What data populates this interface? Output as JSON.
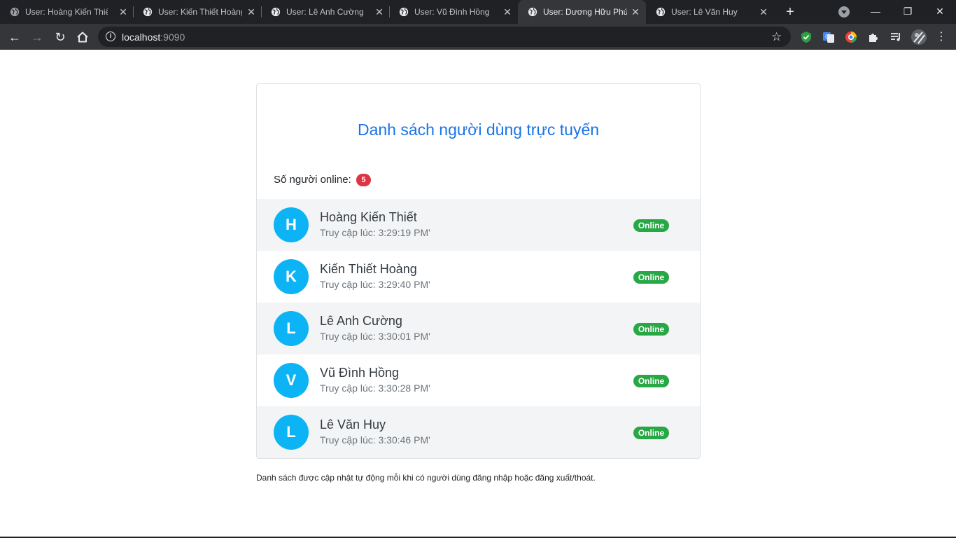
{
  "browser": {
    "tabs": [
      {
        "title": "User: Hoàng Kiến Thiết",
        "active": false
      },
      {
        "title": "User: Kiến Thiết Hoàng",
        "active": false
      },
      {
        "title": "User: Lê Anh Cường",
        "active": false
      },
      {
        "title": "User: Vũ Đình Hồng",
        "active": false
      },
      {
        "title": "User: Dương Hữu Phúc",
        "active": true
      },
      {
        "title": "User: Lê Văn Huy",
        "active": false
      }
    ],
    "address": {
      "host": "localhost",
      "port": ":9090"
    }
  },
  "page": {
    "title": "Danh sách người dùng trực tuyến",
    "online_label": "Số người online:",
    "online_count": "5",
    "users": [
      {
        "initial": "H",
        "name": "Hoàng Kiến Thiết",
        "access_time": "Truy cập lúc: 3:29:19 PM'",
        "status": "Online"
      },
      {
        "initial": "K",
        "name": "Kiến Thiết Hoàng",
        "access_time": "Truy cập lúc: 3:29:40 PM'",
        "status": "Online"
      },
      {
        "initial": "L",
        "name": "Lê Anh Cường",
        "access_time": "Truy cập lúc: 3:30:01 PM'",
        "status": "Online"
      },
      {
        "initial": "V",
        "name": "Vũ Đình Hồng",
        "access_time": "Truy cập lúc: 3:30:28 PM'",
        "status": "Online"
      },
      {
        "initial": "L",
        "name": "Lê Văn Huy",
        "access_time": "Truy cập lúc: 3:30:46 PM'",
        "status": "Online"
      }
    ],
    "footnote": "Danh sách được cập nhật tự động mỗi khi có người dùng đăng nhập hoặc đăng xuất/thoát."
  },
  "colors": {
    "title_blue": "#1a73e8",
    "avatar_cyan": "#0db4f5",
    "online_green": "#28a745",
    "count_red": "#dc3545",
    "row_alt": "#f3f4f5"
  }
}
